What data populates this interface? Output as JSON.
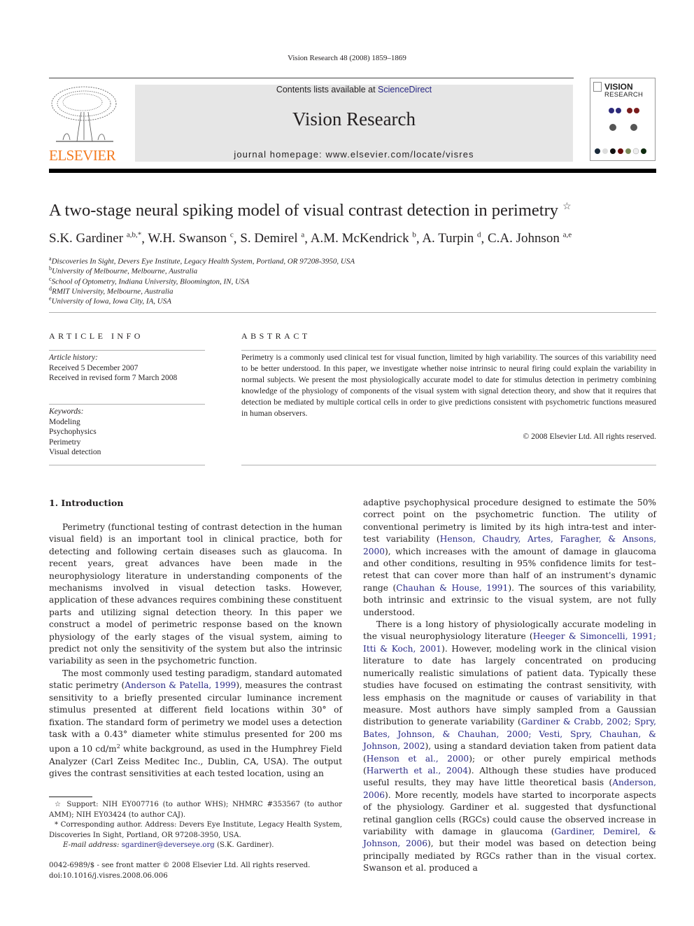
{
  "header": {
    "citation": "Vision Research 48 (2008) 1859–1869",
    "contents_prefix": "Contents lists available at ",
    "contents_link": "ScienceDirect",
    "journal_name": "Vision Research",
    "homepage": "journal homepage: www.elsevier.com/locate/visres",
    "publisher": "ELSEVIER",
    "cover_title_1": "VISION",
    "cover_title_2": "RESEARCH"
  },
  "colors": {
    "link": "#2a2a86",
    "publisher_orange": "#f47b20",
    "banner_gray": "#e6e6e6"
  },
  "article": {
    "title": "A two-stage neural spiking model of visual contrast detection in perimetry",
    "title_mark": "☆",
    "authors": [
      {
        "name": "S.K. Gardiner",
        "sup": "a,b,*",
        "sep": ", "
      },
      {
        "name": "W.H. Swanson",
        "sup": "c",
        "sep": ", "
      },
      {
        "name": "S. Demirel",
        "sup": "a",
        "sep": ", "
      },
      {
        "name": "A.M. McKendrick",
        "sup": "b",
        "sep": ", "
      },
      {
        "name": "A. Turpin",
        "sup": "d",
        "sep": ", "
      },
      {
        "name": "C.A. Johnson",
        "sup": "a,e",
        "sep": ""
      }
    ],
    "affiliations": [
      {
        "key": "a",
        "text": "Discoveries In Sight, Devers Eye Institute, Legacy Health System, Portland, OR 97208-3950, USA"
      },
      {
        "key": "b",
        "text": "University of Melbourne, Melbourne, Australia"
      },
      {
        "key": "c",
        "text": "School of Optometry, Indiana University, Bloomington, IN, USA"
      },
      {
        "key": "d",
        "text": "RMIT University, Melbourne, Australia"
      },
      {
        "key": "e",
        "text": "University of Iowa, Iowa City, IA, USA"
      }
    ]
  },
  "article_info": {
    "label": "ARTICLE INFO",
    "history_label": "Article history:",
    "received": "Received 5 December 2007",
    "revised": "Received in revised form 7 March 2008",
    "keywords_label": "Keywords:",
    "keywords": [
      "Modeling",
      "Psychophysics",
      "Perimetry",
      "Visual detection"
    ]
  },
  "abstract": {
    "label": "ABSTRACT",
    "text": "Perimetry is a commonly used clinical test for visual function, limited by high variability. The sources of this variability need to be better understood. In this paper, we investigate whether noise intrinsic to neural firing could explain the variability in normal subjects. We present the most physiologically accurate model to date for stimulus detection in perimetry combining knowledge of the physiology of components of the visual system with signal detection theory, and show that it requires that detection be mediated by multiple cortical cells in order to give predictions consistent with psychometric functions measured in human observers.",
    "copyright": "© 2008 Elsevier Ltd. All rights reserved."
  },
  "body": {
    "section_heading": "1. Introduction",
    "left": {
      "p1": "Perimetry (functional testing of contrast detection in the human visual field) is an important tool in clinical practice, both for detecting and following certain diseases such as glaucoma. In recent years, great advances have been made in the neurophysiology literature in understanding components of the mechanisms involved in visual detection tasks. However, application of these advances requires combining these constituent parts and utilizing signal detection theory. In this paper we construct a model of perimetric response based on the known physiology of the early stages of the visual system, aiming to predict not only the sensitivity of the system but also the intrinsic variability as seen in the psychometric function.",
      "p2_a": "The most commonly used testing paradigm, standard automated static perimetry (",
      "p2_cite1": "Anderson & Patella, 1999",
      "p2_b": "), measures the contrast sensitivity to a briefly presented circular luminance increment stimulus presented at different field locations within 30° of fixation. The standard form of perimetry we model uses a detection task with a 0.43° diameter white stimulus presented for 200 ms upon a 10 cd/m",
      "p2_sup": "2",
      "p2_c": " white background, as used in the Humphrey Field Analyzer (Carl Zeiss Meditec Inc., Dublin, CA, USA). The output gives the contrast sensitivities at each tested location, using an"
    },
    "right": {
      "p1_a": "adaptive psychophysical procedure designed to estimate the 50% correct point on the psychometric function. The utility of conventional perimetry is limited by its high intra-test and inter-test variability (",
      "p1_cite1": "Henson, Chaudry, Artes, Faragher, & Ansons, 2000",
      "p1_b": "), which increases with the amount of damage in glaucoma and other conditions, resulting in 95% confidence limits for test–retest that can cover more than half of an instrument's dynamic range (",
      "p1_cite2": "Chauhan & House, 1991",
      "p1_c": "). The sources of this variability, both intrinsic and extrinsic to the visual system, are not fully understood.",
      "p2_a": "There is a long history of physiologically accurate modeling in the visual neurophysiology literature (",
      "p2_cite1": "Heeger & Simoncelli, 1991; Itti & Koch, 2001",
      "p2_b": "). However, modeling work in the clinical vision literature to date has largely concentrated on producing numerically realistic simulations of patient data. Typically these studies have focused on estimating the contrast sensitivity, with less emphasis on the magnitude or causes of variability in that measure. Most authors have simply sampled from a Gaussian distribution to generate variability (",
      "p2_cite2": "Gardiner & Crabb, 2002; Spry, Bates, Johnson, & Chauhan, 2000; Vesti, Spry, Chauhan, & Johnson, 2002",
      "p2_c": "), using a standard deviation taken from patient data (",
      "p2_cite3": "Henson et al., 2000",
      "p2_d": "); or other purely empirical methods (",
      "p2_cite4": "Harwerth et al., 2004",
      "p2_e": "). Although these studies have produced useful results, they may have little theoretical basis (",
      "p2_cite5": "Anderson, 2006",
      "p2_f": "). More recently, models have started to incorporate aspects of the physiology. Gardiner et al. suggested that dysfunctional retinal ganglion cells (RGCs) could cause the observed increase in variability with damage in glaucoma (",
      "p2_cite6": "Gardiner, Demirel, & Johnson, 2006",
      "p2_g": "), but their model was based on detection being principally mediated by RGCs rather than in the visual cortex. Swanson et al. produced a"
    }
  },
  "footnotes": {
    "support_mark": "☆",
    "support": " Support: NIH EY007716 (to author WHS); NHMRC #353567 (to author AMM); NIH EY03424 (to author CAJ).",
    "corr_mark": "*",
    "corresponding": " Corresponding author. Address: Devers Eye Institute, Legacy Health System, Discoveries In Sight, Portland, OR 97208-3950, USA.",
    "email_label": "E-mail address: ",
    "email": "sgardiner@deverseye.org",
    "email_suffix": " (S.K. Gardiner).",
    "issn": "0042-6989/$ - see front matter © 2008 Elsevier Ltd. All rights reserved.",
    "doi": "doi:10.1016/j.visres.2008.06.006"
  }
}
